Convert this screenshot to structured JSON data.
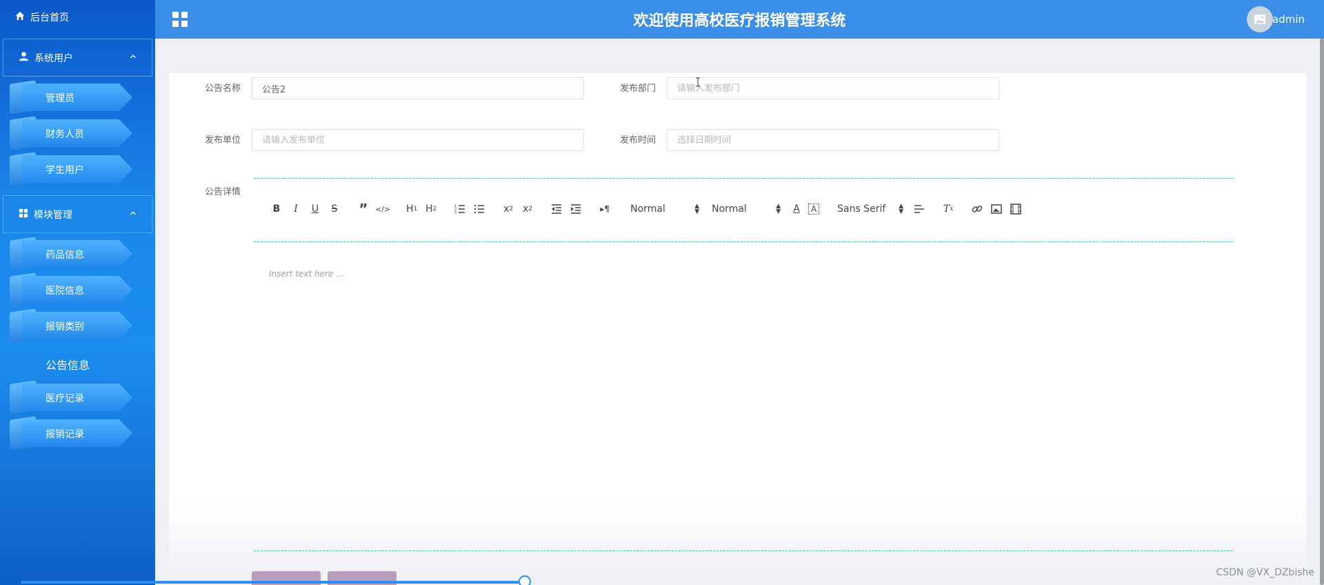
{
  "sidebar": {
    "home_label": "后台首页",
    "groups": [
      {
        "label": "系统用户",
        "items": [
          "管理员",
          "财务人员",
          "学生用户"
        ]
      },
      {
        "label": "模块管理",
        "items": [
          "药品信息",
          "医院信息",
          "报销类别",
          "公告信息",
          "医疗记录",
          "报销记录"
        ]
      }
    ]
  },
  "header": {
    "title": "欢迎使用高校医疗报销管理系统",
    "username": "admin"
  },
  "form": {
    "name_label": "公告名称",
    "name_value": "公告2",
    "dept_label": "发布部门",
    "dept_placeholder": "请输入发布部门",
    "unit_label": "发布单位",
    "unit_placeholder": "请输入发布单位",
    "time_label": "发布时间",
    "time_placeholder": "选择日期时间",
    "detail_label": "公告详情"
  },
  "editor": {
    "header_select": "Normal",
    "size_select": "Normal",
    "font_select": "Sans Serif",
    "placeholder": "Insert text here ..."
  },
  "watermark": "CSDN @VX_DZbishe",
  "colors": {
    "header": "#3a8ee8",
    "sidebar": "#1a86ea",
    "editor_border": "#3bc9a7"
  }
}
